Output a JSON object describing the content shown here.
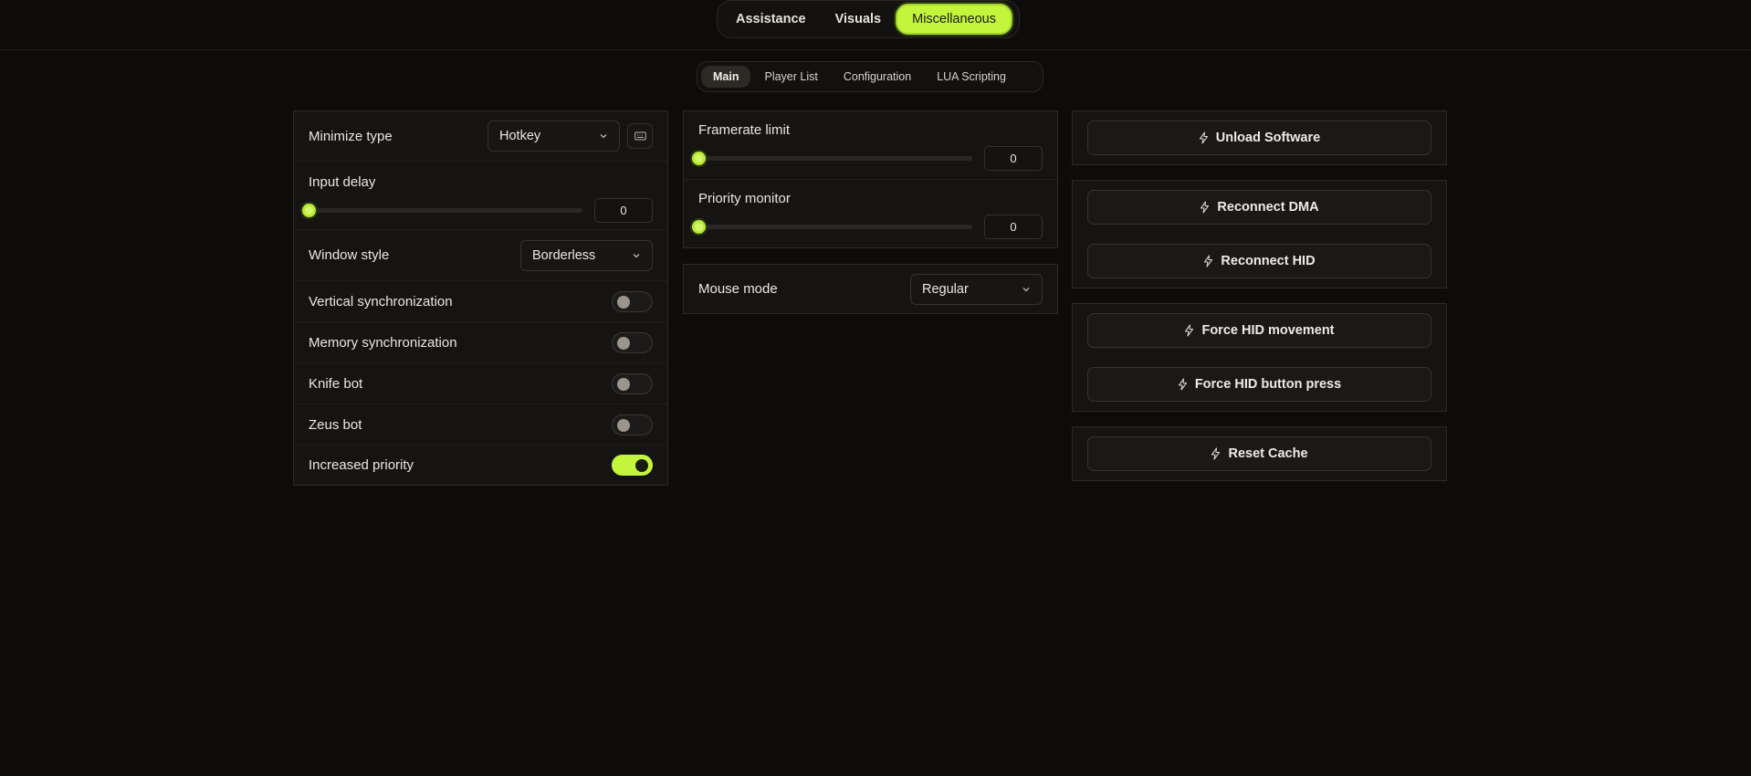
{
  "main_tabs": [
    {
      "label": "Assistance",
      "active": false
    },
    {
      "label": "Visuals",
      "active": false
    },
    {
      "label": "Miscellaneous",
      "active": true
    }
  ],
  "sub_tabs": [
    {
      "label": "Main",
      "active": true
    },
    {
      "label": "Player List",
      "active": false
    },
    {
      "label": "Configuration",
      "active": false
    },
    {
      "label": "LUA Scripting",
      "active": false
    }
  ],
  "left_panel": {
    "minimize_type": {
      "label": "Minimize type",
      "value": "Hotkey",
      "icon": "keyboard-icon"
    },
    "input_delay": {
      "label": "Input delay",
      "value": "0",
      "level": 0
    },
    "window_style": {
      "label": "Window style",
      "value": "Borderless"
    },
    "toggles": [
      {
        "label": "Vertical synchronization",
        "on": false
      },
      {
        "label": "Memory synchronization",
        "on": false
      },
      {
        "label": "Knife bot",
        "on": false
      },
      {
        "label": "Zeus bot",
        "on": false
      },
      {
        "label": "Increased priority",
        "on": true
      }
    ]
  },
  "middle_panel": {
    "framerate_limit": {
      "label": "Framerate limit",
      "value": "0",
      "level": 0
    },
    "priority_monitor": {
      "label": "Priority monitor",
      "value": "0",
      "level": 0
    },
    "mouse_mode": {
      "label": "Mouse mode",
      "value": "Regular"
    }
  },
  "actions": [
    [
      "Unload Software"
    ],
    [
      "Reconnect DMA",
      "Reconnect HID"
    ],
    [
      "Force HID movement",
      "Force HID button press"
    ],
    [
      "Reset Cache"
    ]
  ],
  "action_icon": "lightning-bolt-icon",
  "colors": {
    "accent": "#c3f53c",
    "background": "#0d0c0b",
    "panel": "#151413"
  }
}
